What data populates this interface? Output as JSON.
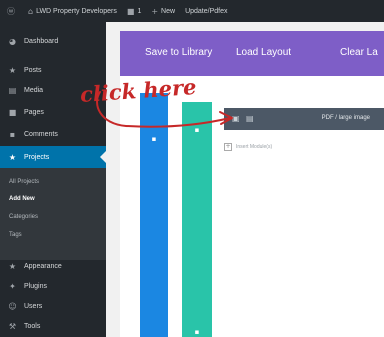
{
  "admin_bar": {
    "wp_icon": "wordpress-logo-icon",
    "site_name": "LWD Property Developers",
    "comments_count": "1",
    "new_label": "New",
    "builder_label": "Update/Pdfex"
  },
  "sidebar": {
    "items": [
      {
        "label": "Dashboard",
        "icon": "dashboard-icon"
      },
      {
        "label": "Posts",
        "icon": "pin-icon"
      },
      {
        "label": "Media",
        "icon": "media-icon"
      },
      {
        "label": "Pages",
        "icon": "pages-icon"
      },
      {
        "label": "Comments",
        "icon": "comments-icon"
      },
      {
        "label": "Projects",
        "icon": "projects-pin-icon",
        "active": true
      },
      {
        "label": "Appearance",
        "icon": "appearance-icon"
      },
      {
        "label": "Plugins",
        "icon": "plugins-icon"
      },
      {
        "label": "Users",
        "icon": "users-icon"
      },
      {
        "label": "Tools",
        "icon": "tools-icon"
      }
    ],
    "submenu": [
      "All Projects",
      "Add New",
      "Categories",
      "Tags"
    ],
    "submenu_current": "Add New"
  },
  "builder": {
    "buttons": [
      "Save to Library",
      "Load Layout",
      "Clear La"
    ],
    "module_title": "PDF / large image",
    "add_module_label": "Insert Module(s)"
  },
  "annotation": {
    "text": "click here"
  },
  "colors": {
    "admin_bg": "#23282d",
    "sidebar_active": "#0073aa",
    "builder_purple": "#7e5ec7",
    "column_blue": "#1b87e2",
    "column_teal": "#29c4a9",
    "module_row": "#4c5866",
    "annotation_red": "#c62828"
  }
}
